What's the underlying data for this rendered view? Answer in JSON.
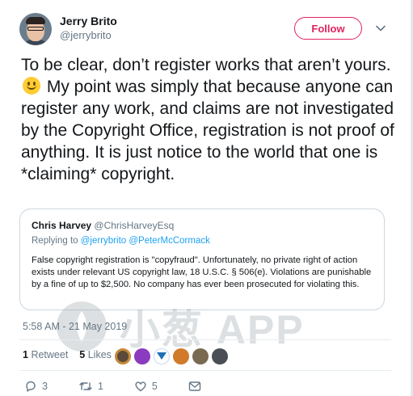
{
  "author": {
    "display_name": "Jerry Brito",
    "handle": "@jerrybrito",
    "follow_label": "Follow"
  },
  "tweet": {
    "text_before_emoji": "To be clear, don’t register works that aren’t yours.",
    "emoji": "slightly-smiling-face",
    "text_after_emoji": " My point was simply that because anyone can register any work, and claims are not investigated by the Copyright Office, registration is not proof of anything. It is just notice to the world that one is *claiming* copyright."
  },
  "quote": {
    "name": "Chris Harvey",
    "handle": "@ChrisHarveyEsq",
    "replying_prefix": "Replying to",
    "replying_to": [
      "@jerrybrito",
      "@PeterMcCormack"
    ],
    "body": "False copyright registration is \"copyfraud\". Unfortunately, no private right of action exists under relevant US copyright law, 18 U.S.C. § 506(e). Violations are punishable by a fine of up to $2,500. No company has ever been prosecuted for violating this."
  },
  "timestamp": "5:58 AM - 21 May 2019",
  "stats": {
    "retweets_count": "1",
    "retweets_label": "Retweet",
    "likes_count": "5",
    "likes_label": "Likes"
  },
  "actions": {
    "replies": "3",
    "retweets": "1",
    "likes": "5"
  },
  "watermark": {
    "text": "小葱 APP"
  },
  "colors": {
    "accent_pink": "#e0245e",
    "link_blue": "#1da1f2",
    "secondary_text": "#657786",
    "primary_text": "#14171a",
    "border": "#ccd6dd"
  }
}
